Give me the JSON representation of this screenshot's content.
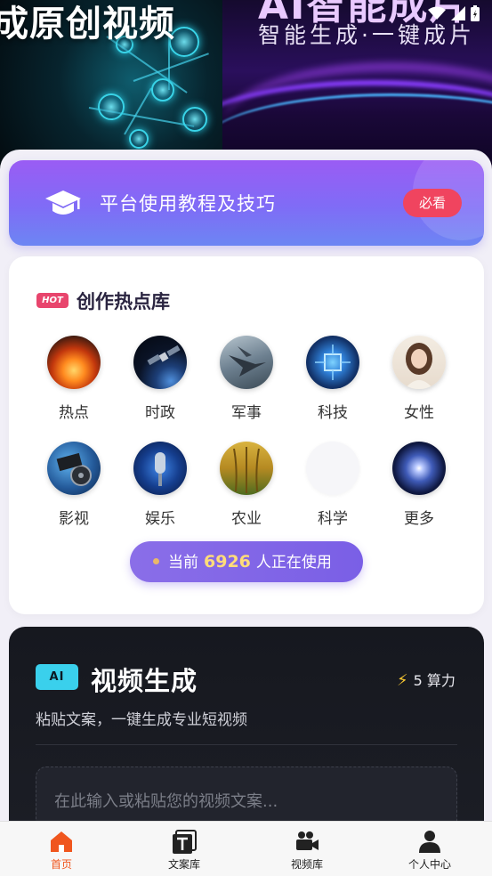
{
  "banner": {
    "left_text": "成原创视频",
    "right_title": "AI智能成片",
    "right_subtitle": "智能生成·一键成片"
  },
  "tutorial": {
    "label": "平台使用教程及技巧",
    "button": "必看",
    "icon": "graduation-cap-icon"
  },
  "hotspot": {
    "badge": "HOT",
    "title": "创作热点库",
    "categories": [
      {
        "label": "热点",
        "icon": "bonfire-image"
      },
      {
        "label": "时政",
        "icon": "satellite-image"
      },
      {
        "label": "军事",
        "icon": "fighter-jet-image"
      },
      {
        "label": "科技",
        "icon": "chip-image"
      },
      {
        "label": "女性",
        "icon": "woman-portrait-image"
      },
      {
        "label": "影视",
        "icon": "film-reel-image"
      },
      {
        "label": "娱乐",
        "icon": "microphone-image"
      },
      {
        "label": "农业",
        "icon": "wheat-image"
      },
      {
        "label": "科学",
        "icon": "science-placeholder"
      },
      {
        "label": "更多",
        "icon": "galaxy-image"
      }
    ],
    "users": {
      "prefix": "当前",
      "count": "6926",
      "suffix": "人正在使用"
    }
  },
  "generator": {
    "badge": "AI",
    "title": "视频生成",
    "power_value": "5",
    "power_unit": "算力",
    "subtitle": "粘贴文案，一键生成专业短视频",
    "input_placeholder": "在此输入或粘贴您的视频文案..."
  },
  "nav": {
    "items": [
      {
        "label": "首页",
        "icon": "home-icon",
        "active": true
      },
      {
        "label": "文案库",
        "icon": "text-library-icon",
        "active": false
      },
      {
        "label": "视频库",
        "icon": "video-camera-icon",
        "active": false
      },
      {
        "label": "个人中心",
        "icon": "person-icon",
        "active": false
      }
    ]
  },
  "colors": {
    "accent_purple": "#8a6ee8",
    "hot_badge": "#e8456d",
    "must_button": "#f0445f",
    "ai_badge": "#3ad0ec",
    "nav_active": "#f0561e"
  }
}
